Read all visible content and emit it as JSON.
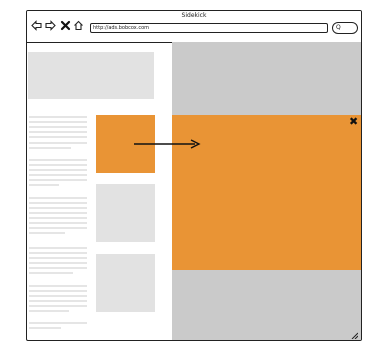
{
  "window": {
    "title": "Sidekick"
  },
  "nav": {
    "back": "back-arrow",
    "forward": "forward-arrow",
    "stop": "close-x",
    "home": "home"
  },
  "address_bar": {
    "url": "http://ads.bobcox.com"
  },
  "search_button": {
    "glyph": "search"
  },
  "colors": {
    "accent": "#e99435",
    "panel": "#cacaca",
    "placeholder": "#e2e2e2"
  }
}
